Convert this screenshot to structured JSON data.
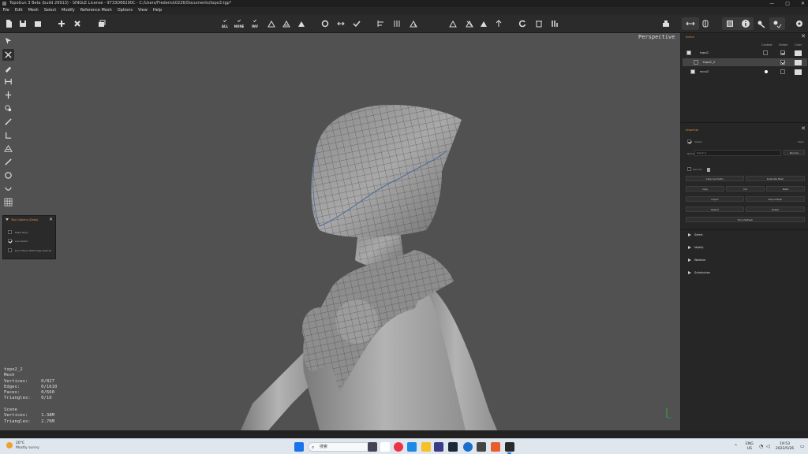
{
  "window": {
    "title": "TopoGun 3 Beta (build 26913) - SINGLE License - 9733D66290C - C:/Users/Frederick0226/Documents/topo3.tgp*",
    "controls": [
      "—",
      "□",
      "✕"
    ]
  },
  "menu": [
    "File",
    "Edit",
    "Mesh",
    "Select",
    "Modify",
    "Reference Mesh",
    "Options",
    "View",
    "Help"
  ],
  "toolbar": {
    "select_all_label": "ALL",
    "select_none_label": "NONE",
    "select_inv_label": "INV",
    "icons": [
      "new-file-icon",
      "save-icon",
      "save-as-icon",
      "add-icon",
      "close-icon",
      "export-icon",
      "select-all-icon",
      "select-none-icon",
      "select-invert-icon",
      "grow-selection-icon",
      "shrink-selection-icon",
      "select-triangles-icon",
      "select-loop-icon",
      "select-ring-icon",
      "confirm-icon",
      "align-icon",
      "distribute-icon",
      "relax-icon",
      "symmetry-x-icon",
      "symmetry-y-icon",
      "symmetry-z-icon",
      "symmetry-axis-icon",
      "rotate-icon",
      "delete-icon",
      "tools-icon",
      "render-icon",
      "arrows-icon",
      "mirror-icon",
      "scene-icon",
      "info-icon",
      "snap-icon",
      "snap-check-icon",
      "settings-icon"
    ]
  },
  "viewport": {
    "camera": "Perspective",
    "background": "#515151"
  },
  "left_tools": [
    "select-tool-icon",
    "edit-tool-icon",
    "draw-tool-icon",
    "bridge-tool-icon",
    "split-tool-icon",
    "loop-tool-icon",
    "brush-tool-icon",
    "extrude-tool-icon",
    "fill-tool-icon",
    "knife-tool-icon",
    "circle-tool-icon",
    "tube-tool-icon",
    "grid-tool-icon"
  ],
  "tool_panel": {
    "title": "Tool Options (Draw)",
    "options": [
      {
        "label": "Make Polys",
        "checked": false
      },
      {
        "label": "Live Select",
        "checked": true
      },
      {
        "label": "Don't Move With Edge Vertices",
        "checked": false
      }
    ]
  },
  "stats": {
    "object": "topo2_2",
    "type": "Mesh",
    "vertices_label": "Vertices:",
    "vertices": "0/827",
    "edges_label": "Edges:",
    "edges": "0/1610",
    "faces_label": "Faces:",
    "faces": "0/660",
    "triangles_label": "Triangles:",
    "triangles": "0/16",
    "scene_label": "Scene",
    "scene_vertices_label": "Vertices:",
    "scene_vertices": "1.38M",
    "scene_triangles_label": "Triangles:",
    "scene_triangles": "2.76M"
  },
  "scene": {
    "title": "Scene",
    "columns": [
      "Context",
      "Visible",
      "Color"
    ],
    "rows": [
      {
        "name": "topo2",
        "context": false,
        "visible": true
      },
      {
        "name": "topo2_2",
        "context": false,
        "visible": true,
        "selected": true
      },
      {
        "name": "ecco2",
        "context": true,
        "visible": false
      }
    ]
  },
  "inspector": {
    "title": "Inspector",
    "visible_label": "Visible",
    "mesh_label": "Mesh",
    "name_label": "Name",
    "name_value": "topo2_2",
    "rename_button": "Rename",
    "opacity_label": "Opacity",
    "buttons": [
      "Clear Geometry",
      "Duplicate Mesh",
      "Copy",
      "Cut",
      "Paste",
      "Import",
      "Export Mesh",
      "Reload",
      "Delete",
      "Force Refresh"
    ],
    "sections": [
      "Select",
      "Modify",
      "Weather",
      "Subdivision"
    ]
  },
  "taskbar": {
    "weather_temp": "20°C",
    "weather_desc": "Mostly sunny",
    "search_placeholder": "搜索",
    "lang": "ENG",
    "region": "US",
    "time": "19:53",
    "date": "2023/5/26"
  },
  "colors": {
    "accent": "#e0903a",
    "panel": "#262626",
    "viewport": "#515151"
  }
}
